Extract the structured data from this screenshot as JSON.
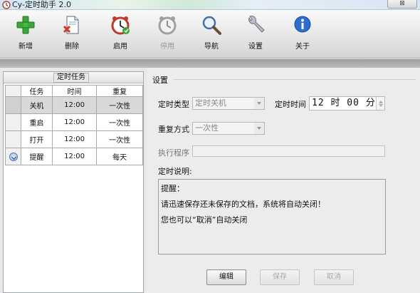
{
  "window": {
    "title": "Cy-定时助手 2.0",
    "close_glyph": "⊠"
  },
  "toolbar": {
    "items": [
      {
        "label": "新增",
        "icon": "add-icon"
      },
      {
        "label": "删除",
        "icon": "delete-icon"
      },
      {
        "label": "启用",
        "icon": "enable-clock-icon"
      },
      {
        "label": "停用",
        "icon": "disable-clock-icon",
        "disabled": true
      },
      {
        "label": "导航",
        "icon": "magnifier-icon"
      },
      {
        "label": "设置",
        "icon": "wrench-icon"
      },
      {
        "label": "关于",
        "icon": "info-icon"
      }
    ]
  },
  "tasks_panel": {
    "title": "定时任务",
    "columns": [
      "任务",
      "时间",
      "重复"
    ],
    "rows": [
      {
        "task": "关机",
        "time": "12:00",
        "repeat": "一次性",
        "selected": true
      },
      {
        "task": "重启",
        "time": "12:00",
        "repeat": "一次性"
      },
      {
        "task": "打开",
        "time": "12:00",
        "repeat": "一次性"
      },
      {
        "task": "提醒",
        "time": "12:00",
        "repeat": "每天",
        "current": true
      }
    ]
  },
  "settings": {
    "title": "设置",
    "type_label": "定时类型",
    "type_value": "定时关机",
    "time_label": "定时时间",
    "time_value": "12 时 00 分",
    "repeat_label": "重复方式",
    "repeat_value": "一次性",
    "program_label": "执行程序",
    "program_value": "",
    "desc_label": "定时说明:",
    "desc_lines": [
      "提醒：",
      "请迅速保存还未保存的文档，系统将自动关闭！",
      "您也可以“取消”自动关闭"
    ],
    "edit_label": "编辑",
    "save_label": "保存",
    "cancel_label": "取消"
  },
  "colors": {
    "accent_green": "#3aa63a",
    "accent_red": "#d23a2a",
    "info_blue": "#2a6fd1"
  }
}
